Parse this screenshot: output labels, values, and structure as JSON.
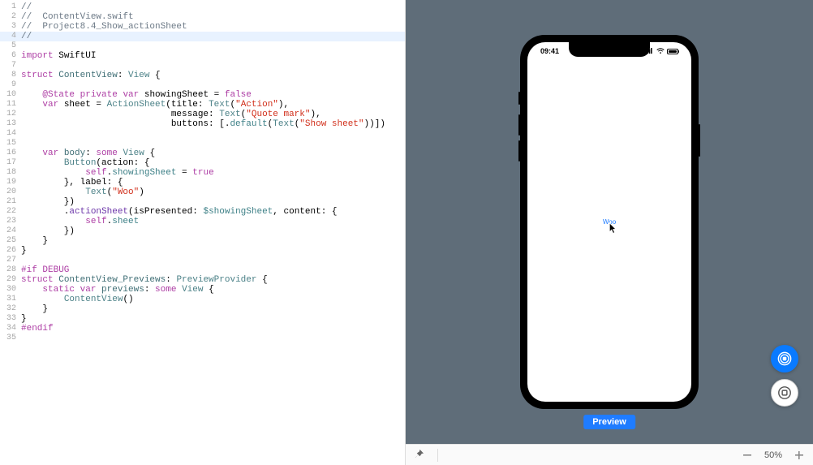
{
  "code": {
    "lines": [
      {
        "n": 1,
        "segs": [
          [
            "//",
            "comment"
          ]
        ]
      },
      {
        "n": 2,
        "segs": [
          [
            "//  ContentView.swift",
            "comment"
          ]
        ]
      },
      {
        "n": 3,
        "segs": [
          [
            "//  Project8.4_Show_actionSheet",
            "comment"
          ]
        ]
      },
      {
        "n": 4,
        "segs": [
          [
            "//",
            "comment"
          ]
        ],
        "hl": true
      },
      {
        "n": 5,
        "segs": [
          [
            "",
            ""
          ]
        ]
      },
      {
        "n": 6,
        "segs": [
          [
            "import ",
            "keyword"
          ],
          [
            "SwiftUI",
            ""
          ]
        ]
      },
      {
        "n": 7,
        "segs": [
          [
            "",
            ""
          ]
        ]
      },
      {
        "n": 8,
        "segs": [
          [
            "struct ",
            "keyword"
          ],
          [
            "ContentView",
            "decl"
          ],
          [
            ": ",
            ""
          ],
          [
            "View",
            "type"
          ],
          [
            " {",
            ""
          ]
        ]
      },
      {
        "n": 9,
        "segs": [
          [
            "",
            ""
          ]
        ]
      },
      {
        "n": 10,
        "segs": [
          [
            "    ",
            ""
          ],
          [
            "@State",
            "attr"
          ],
          [
            " ",
            ""
          ],
          [
            "private ",
            "keyword"
          ],
          [
            "var ",
            "keyword"
          ],
          [
            "showingSheet",
            ""
          ],
          [
            " = ",
            ""
          ],
          [
            "false",
            "keyword"
          ]
        ]
      },
      {
        "n": 11,
        "segs": [
          [
            "    ",
            ""
          ],
          [
            "var ",
            "keyword"
          ],
          [
            "sheet",
            ""
          ],
          [
            " = ",
            ""
          ],
          [
            "ActionSheet",
            "type"
          ],
          [
            "(title: ",
            ""
          ],
          [
            "Text",
            "type"
          ],
          [
            "(",
            ""
          ],
          [
            "\"Action\"",
            "string"
          ],
          [
            "),",
            ""
          ]
        ]
      },
      {
        "n": 12,
        "segs": [
          [
            "                            message: ",
            ""
          ],
          [
            "Text",
            "type"
          ],
          [
            "(",
            ""
          ],
          [
            "\"Quote mark\"",
            "string"
          ],
          [
            "),",
            ""
          ]
        ]
      },
      {
        "n": 13,
        "segs": [
          [
            "                            buttons: [.",
            ""
          ],
          [
            "default",
            "prop"
          ],
          [
            "(",
            ""
          ],
          [
            "Text",
            "type"
          ],
          [
            "(",
            ""
          ],
          [
            "\"Show sheet\"",
            "string"
          ],
          [
            "))])",
            ""
          ]
        ]
      },
      {
        "n": 14,
        "segs": [
          [
            "",
            ""
          ]
        ]
      },
      {
        "n": 15,
        "segs": [
          [
            "",
            ""
          ]
        ]
      },
      {
        "n": 16,
        "segs": [
          [
            "    ",
            ""
          ],
          [
            "var ",
            "keyword"
          ],
          [
            "body",
            "decl"
          ],
          [
            ": ",
            ""
          ],
          [
            "some ",
            "keyword"
          ],
          [
            "View",
            "type"
          ],
          [
            " {",
            ""
          ]
        ]
      },
      {
        "n": 17,
        "segs": [
          [
            "        ",
            ""
          ],
          [
            "Button",
            "type"
          ],
          [
            "(action: {",
            ""
          ]
        ]
      },
      {
        "n": 18,
        "segs": [
          [
            "            ",
            ""
          ],
          [
            "self",
            "keyword"
          ],
          [
            ".",
            ""
          ],
          [
            "showingSheet",
            "prop"
          ],
          [
            " = ",
            ""
          ],
          [
            "true",
            "keyword"
          ]
        ]
      },
      {
        "n": 19,
        "segs": [
          [
            "        }, label: {",
            ""
          ]
        ]
      },
      {
        "n": 20,
        "segs": [
          [
            "            ",
            ""
          ],
          [
            "Text",
            "type"
          ],
          [
            "(",
            ""
          ],
          [
            "\"Woo\"",
            "string"
          ],
          [
            ")",
            ""
          ]
        ]
      },
      {
        "n": 21,
        "segs": [
          [
            "        })",
            ""
          ]
        ]
      },
      {
        "n": 22,
        "segs": [
          [
            "        .",
            ""
          ],
          [
            "actionSheet",
            "member"
          ],
          [
            "(isPresented: ",
            ""
          ],
          [
            "$showingSheet",
            "prop"
          ],
          [
            ", content: {",
            ""
          ]
        ]
      },
      {
        "n": 23,
        "segs": [
          [
            "            ",
            ""
          ],
          [
            "self",
            "keyword"
          ],
          [
            ".",
            ""
          ],
          [
            "sheet",
            "prop"
          ]
        ]
      },
      {
        "n": 24,
        "segs": [
          [
            "        })",
            ""
          ]
        ]
      },
      {
        "n": 25,
        "segs": [
          [
            "    }",
            ""
          ]
        ]
      },
      {
        "n": 26,
        "segs": [
          [
            "}",
            ""
          ]
        ]
      },
      {
        "n": 27,
        "segs": [
          [
            "",
            ""
          ]
        ]
      },
      {
        "n": 28,
        "segs": [
          [
            "#if DEBUG",
            "keyword"
          ]
        ]
      },
      {
        "n": 29,
        "segs": [
          [
            "struct ",
            "keyword"
          ],
          [
            "ContentView_Previews",
            "decl"
          ],
          [
            ": ",
            ""
          ],
          [
            "PreviewProvider",
            "type"
          ],
          [
            " {",
            ""
          ]
        ]
      },
      {
        "n": 30,
        "segs": [
          [
            "    ",
            ""
          ],
          [
            "static ",
            "keyword"
          ],
          [
            "var ",
            "keyword"
          ],
          [
            "previews",
            "decl"
          ],
          [
            ": ",
            ""
          ],
          [
            "some ",
            "keyword"
          ],
          [
            "View",
            "type"
          ],
          [
            " {",
            ""
          ]
        ]
      },
      {
        "n": 31,
        "segs": [
          [
            "        ",
            ""
          ],
          [
            "ContentView",
            "type"
          ],
          [
            "()",
            ""
          ]
        ]
      },
      {
        "n": 32,
        "segs": [
          [
            "    }",
            ""
          ]
        ]
      },
      {
        "n": 33,
        "segs": [
          [
            "}",
            ""
          ]
        ]
      },
      {
        "n": 34,
        "segs": [
          [
            "#endif",
            "keyword"
          ]
        ]
      },
      {
        "n": 35,
        "segs": [
          [
            "",
            ""
          ]
        ]
      }
    ]
  },
  "preview": {
    "time": "09:41",
    "button_text": "Woo",
    "label": "Preview",
    "zoom": "50%"
  }
}
